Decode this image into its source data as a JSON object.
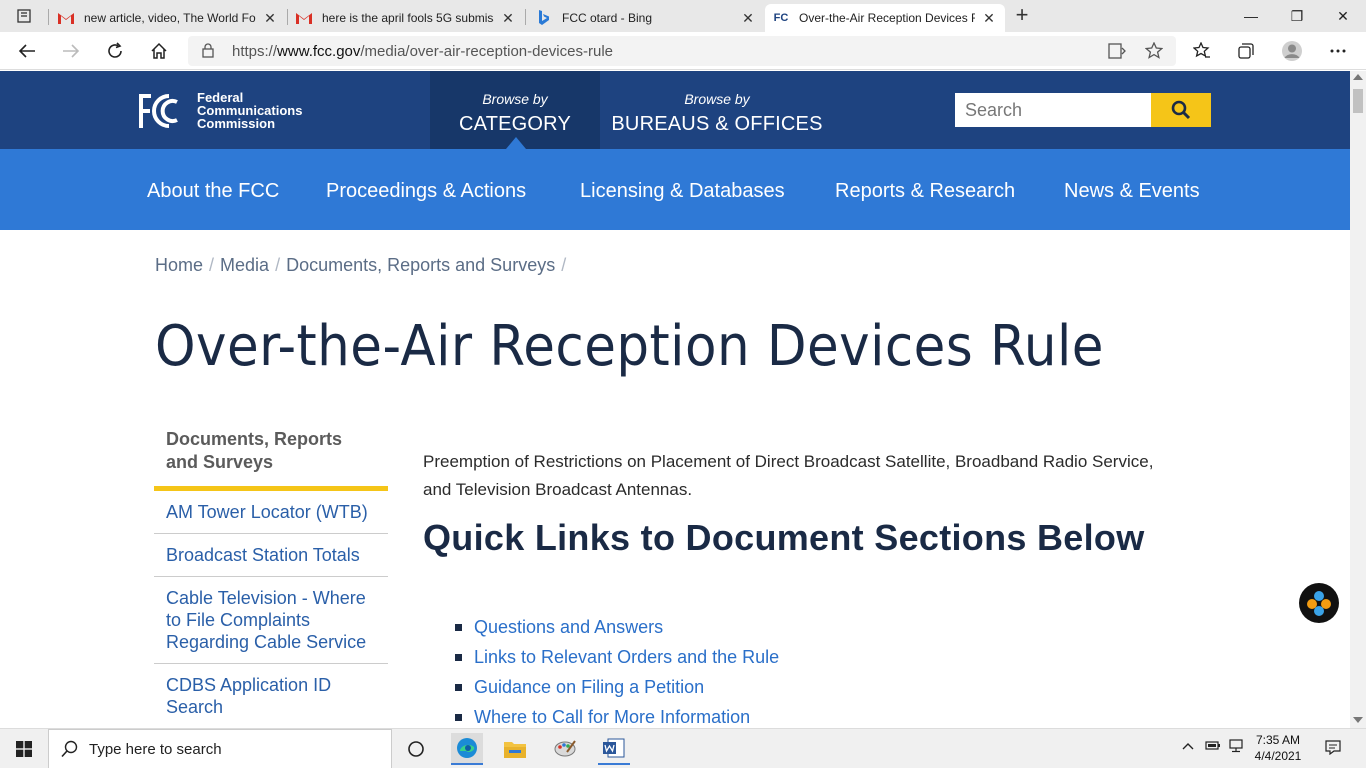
{
  "browser": {
    "tabs": [
      {
        "title": "new article, video, The World Fo"
      },
      {
        "title": "here is the april fools 5G submiss"
      },
      {
        "title": "FCC otard - Bing"
      },
      {
        "title": "Over-the-Air Reception Devices R"
      }
    ],
    "url_prefix": "https://",
    "url_domain": "www.fcc.gov",
    "url_path": "/media/over-air-reception-devices-rule"
  },
  "header": {
    "logo_mark": "FCC",
    "logo_line1": "Federal",
    "logo_line2": "Communications",
    "logo_line3": "Commission",
    "browse_by": "Browse by",
    "category": "CATEGORY",
    "bureaus": "BUREAUS & OFFICES",
    "search_placeholder": "Search"
  },
  "nav": {
    "items": [
      {
        "label": "About the FCC"
      },
      {
        "label": "Proceedings & Actions"
      },
      {
        "label": "Licensing & Databases"
      },
      {
        "label": "Reports & Research"
      },
      {
        "label": "News & Events"
      }
    ]
  },
  "breadcrumb": {
    "items": [
      "Home",
      "Media",
      "Documents, Reports and Surveys"
    ],
    "separator": "/"
  },
  "page": {
    "title": "Over-the-Air Reception Devices Rule",
    "intro": "Preemption of Restrictions on Placement of Direct Broadcast Satellite, Broadband Radio Service, and Television Broadcast Antennas.",
    "quick_links_heading": "Quick Links to Document Sections Below",
    "quick_links": [
      "Questions and Answers",
      "Links to Relevant Orders and the Rule",
      "Guidance on Filing a Petition",
      "Where to Call for More Information"
    ]
  },
  "sidebar": {
    "heading": "Documents, Reports and Surveys",
    "items": [
      "AM Tower Locator (WTB)",
      "Broadcast Station Totals",
      "Cable Television - Where to File Complaints Regarding Cable Service",
      "CDBS Application ID Search"
    ]
  },
  "taskbar": {
    "search_placeholder": "Type here to search",
    "time": "7:35 AM",
    "date": "4/4/2021"
  },
  "colors": {
    "header_dark": "#1e4380",
    "nav_blue": "#2f79d6",
    "accent_yellow": "#f5c518",
    "link_blue": "#2a6fc9"
  }
}
